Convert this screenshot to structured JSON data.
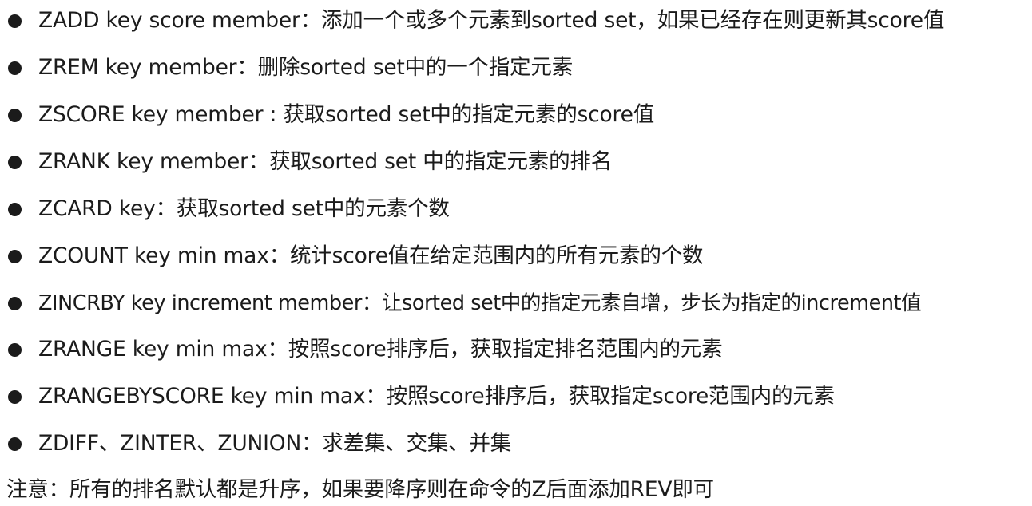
{
  "commands": [
    {
      "text": "ZADD key score member：添加一个或多个元素到sorted set，如果已经存在则更新其score值"
    },
    {
      "text": "ZREM key member：删除sorted set中的一个指定元素"
    },
    {
      "text": "ZSCORE key member : 获取sorted set中的指定元素的score值"
    },
    {
      "text": "ZRANK key member：获取sorted set 中的指定元素的排名"
    },
    {
      "text": "ZCARD key：获取sorted set中的元素个数"
    },
    {
      "text": "ZCOUNT key min max：统计score值在给定范围内的所有元素的个数"
    },
    {
      "text": "ZINCRBY key increment member：让sorted set中的指定元素自增，步长为指定的increment值"
    },
    {
      "text": "ZRANGE key min max：按照score排序后，获取指定排名范围内的元素"
    },
    {
      "text": "ZRANGEBYSCORE key min max：按照score排序后，获取指定score范围内的元素"
    },
    {
      "text": "ZDIFF、ZINTER、ZUNION：求差集、交集、并集"
    }
  ],
  "note": "注意：所有的排名默认都是升序，如果要降序则在命令的Z后面添加REV即可",
  "colors": {
    "text": "#1b1b1b",
    "background": "#ffffff"
  },
  "icons": {
    "bullet": "filled-circle"
  }
}
